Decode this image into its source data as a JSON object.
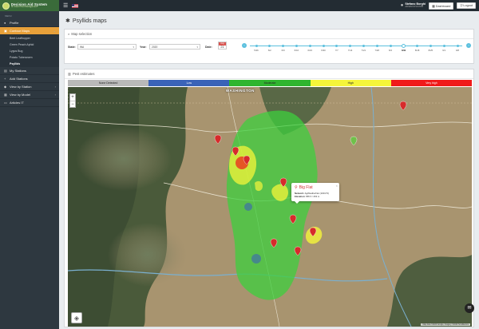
{
  "app": {
    "logo_line1": "Decision Aid System",
    "logo_line2": "for Insect Pest Management",
    "flag_icon": "us-flag-icon"
  },
  "user": {
    "name": "Stefano Borghi",
    "subtitle": "ADMINISTRATOR",
    "dashboard_label": "Dashboard",
    "logout_label": "Logout"
  },
  "sidebar": {
    "menu_header": "MENU",
    "items": [
      {
        "label": "Profile",
        "icon": "user-icon"
      },
      {
        "label": "Contour Maps",
        "icon": "map-icon",
        "active": true
      }
    ],
    "subitems": [
      {
        "label": "Beet Leafhopper"
      },
      {
        "label": "Green Peach Aphid"
      },
      {
        "label": "Lygus Bug"
      },
      {
        "label": "Potato Tuberworm"
      },
      {
        "label": "Psyllids",
        "current": true
      }
    ],
    "more": [
      {
        "label": "My Stations",
        "icon": "station-icon"
      },
      {
        "label": "Add Stations",
        "icon": "plus-icon"
      },
      {
        "label": "View by Station",
        "icon": "pin-icon"
      },
      {
        "label": "View by Model",
        "icon": "grid-icon"
      },
      {
        "label": "Articles IT",
        "icon": "doc-icon"
      }
    ]
  },
  "page": {
    "title": "Psyllids maps"
  },
  "selection": {
    "header": "Map selection",
    "state_label": "State:",
    "state_value": "WA",
    "year_label": "Year:",
    "year_value": "2020",
    "date_label": "Date:",
    "cal_month": "Aug",
    "cal_day": "21",
    "timeline": [
      "5/26",
      "6/2",
      "6/9",
      "6/16",
      "6/23",
      "6/30",
      "7/7",
      "7/14",
      "7/21",
      "7/28",
      "8/4",
      "8/11",
      "8/18",
      "8/25",
      "9/1",
      "9/8"
    ],
    "selected_index": 11
  },
  "estimates": {
    "header": "Pest estimates",
    "legend": [
      {
        "label": "None Detected",
        "color": "#b9b9b9"
      },
      {
        "label": "Low",
        "color": "#3a63b8"
      },
      {
        "label": "Moderate",
        "color": "#2fb52f"
      },
      {
        "label": "High",
        "color": "#f5f53a"
      },
      {
        "label": "Very high",
        "color": "#f01a1a"
      }
    ]
  },
  "map": {
    "state_label": "WASHINGTON",
    "popup": {
      "title": "Big Flat",
      "network_label": "Network:",
      "network_value": "AgWeatherNet (100173)",
      "elevation_label": "Elevation:",
      "elevation_value": "865 ft / 263 m"
    },
    "zoom_in": "+",
    "zoom_out": "−",
    "attribution": "Map data ©2020 Google, Imagery ©2020 TerraMetrics"
  }
}
